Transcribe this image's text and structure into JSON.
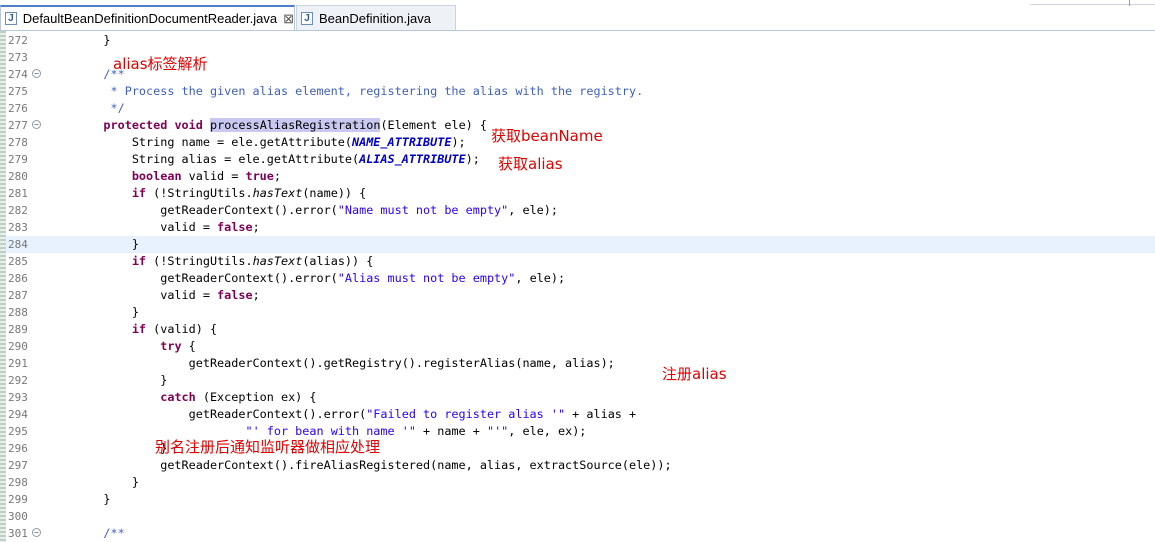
{
  "tabs": [
    {
      "label": "DefaultBeanDefinitionDocumentReader.java",
      "active": true,
      "icon": "java-file-icon"
    },
    {
      "label": "BeanDefinition.java",
      "active": false,
      "icon": "java-file-icon"
    }
  ],
  "tab_close_glyph": "⊠",
  "colors": {
    "keyword": "#7f0055",
    "string": "#2a00ff",
    "comment": "#3f5fbf",
    "constant": "#0000c0",
    "annotation": "#e00000",
    "current_line": "#e8f2fe"
  },
  "lines": [
    {
      "n": "272",
      "t": [
        "    }"
      ]
    },
    {
      "n": "273",
      "t": [
        ""
      ]
    },
    {
      "n": "274",
      "fold": true,
      "t": [
        "    ",
        {
          "c": "cm",
          "s": "/**"
        }
      ]
    },
    {
      "n": "275",
      "t": [
        {
          "c": "cm",
          "s": "     * Process the given alias element, registering the alias with the registry."
        }
      ]
    },
    {
      "n": "276",
      "t": [
        {
          "c": "cm",
          "s": "     */"
        }
      ]
    },
    {
      "n": "277",
      "fold": true,
      "t": [
        "    ",
        {
          "c": "kw",
          "s": "protected"
        },
        " ",
        {
          "c": "kw",
          "s": "void"
        },
        " ",
        {
          "c": "selw",
          "s": "processAliasRegistration"
        },
        "(Element ele) {"
      ]
    },
    {
      "n": "278",
      "t": [
        "        String name = ele.getAttribute(",
        {
          "c": "const",
          "s": "NAME_ATTRIBUTE"
        },
        ");"
      ]
    },
    {
      "n": "279",
      "t": [
        "        String alias = ele.getAttribute(",
        {
          "c": "const",
          "s": "ALIAS_ATTRIBUTE"
        },
        ");"
      ]
    },
    {
      "n": "280",
      "t": [
        "        ",
        {
          "c": "kw",
          "s": "boolean"
        },
        " valid = ",
        {
          "c": "kw",
          "s": "true"
        },
        ";"
      ]
    },
    {
      "n": "281",
      "t": [
        "        ",
        {
          "c": "kw",
          "s": "if"
        },
        " (!StringUtils.",
        {
          "c": "st",
          "s": "hasText"
        },
        "(name)) {"
      ]
    },
    {
      "n": "282",
      "t": [
        "            getReaderContext().error(",
        {
          "c": "str",
          "s": "\"Name must not be empty\""
        },
        ", ele);"
      ]
    },
    {
      "n": "283",
      "t": [
        "            valid = ",
        {
          "c": "kw",
          "s": "false"
        },
        ";"
      ]
    },
    {
      "n": "284",
      "hl": true,
      "t": [
        "        }"
      ]
    },
    {
      "n": "285",
      "t": [
        "        ",
        {
          "c": "kw",
          "s": "if"
        },
        " (!StringUtils.",
        {
          "c": "st",
          "s": "hasText"
        },
        "(alias)) {"
      ]
    },
    {
      "n": "286",
      "t": [
        "            getReaderContext().error(",
        {
          "c": "str",
          "s": "\"Alias must not be empty\""
        },
        ", ele);"
      ]
    },
    {
      "n": "287",
      "t": [
        "            valid = ",
        {
          "c": "kw",
          "s": "false"
        },
        ";"
      ]
    },
    {
      "n": "288",
      "t": [
        "        }"
      ]
    },
    {
      "n": "289",
      "t": [
        "        ",
        {
          "c": "kw",
          "s": "if"
        },
        " (valid) {"
      ]
    },
    {
      "n": "290",
      "t": [
        "            ",
        {
          "c": "kw",
          "s": "try"
        },
        " {"
      ]
    },
    {
      "n": "291",
      "t": [
        "                getReaderContext().getRegistry().registerAlias(name, alias);"
      ]
    },
    {
      "n": "292",
      "t": [
        "            }"
      ]
    },
    {
      "n": "293",
      "t": [
        "            ",
        {
          "c": "kw",
          "s": "catch"
        },
        " (Exception ex) {"
      ]
    },
    {
      "n": "294",
      "t": [
        "                getReaderContext().error(",
        {
          "c": "str",
          "s": "\"Failed to register alias '\""
        },
        " + alias +"
      ]
    },
    {
      "n": "295",
      "t": [
        "                        ",
        {
          "c": "str",
          "s": "\"' for bean with name '\""
        },
        " + name + ",
        {
          "c": "str",
          "s": "\"'\""
        },
        ", ele, ex);"
      ]
    },
    {
      "n": "296",
      "t": [
        "            }"
      ]
    },
    {
      "n": "297",
      "t": [
        "            getReaderContext().fireAliasRegistered(name, alias, extractSource(ele));"
      ]
    },
    {
      "n": "298",
      "t": [
        "        }"
      ]
    },
    {
      "n": "299",
      "t": [
        "    }"
      ]
    },
    {
      "n": "300",
      "t": [
        ""
      ]
    },
    {
      "n": "301",
      "fold": true,
      "t": [
        "    ",
        {
          "c": "cm",
          "s": "/**"
        }
      ]
    }
  ],
  "annotations": [
    {
      "id": "alias-tag-parse",
      "text": "alias标签解析"
    },
    {
      "id": "get-beanname",
      "text": "获取beanName"
    },
    {
      "id": "get-alias",
      "text": "获取alias"
    },
    {
      "id": "register-alias",
      "text": "注册alias"
    },
    {
      "id": "notify-listener",
      "text": "别名注册后通知监听器做相应处理"
    }
  ]
}
